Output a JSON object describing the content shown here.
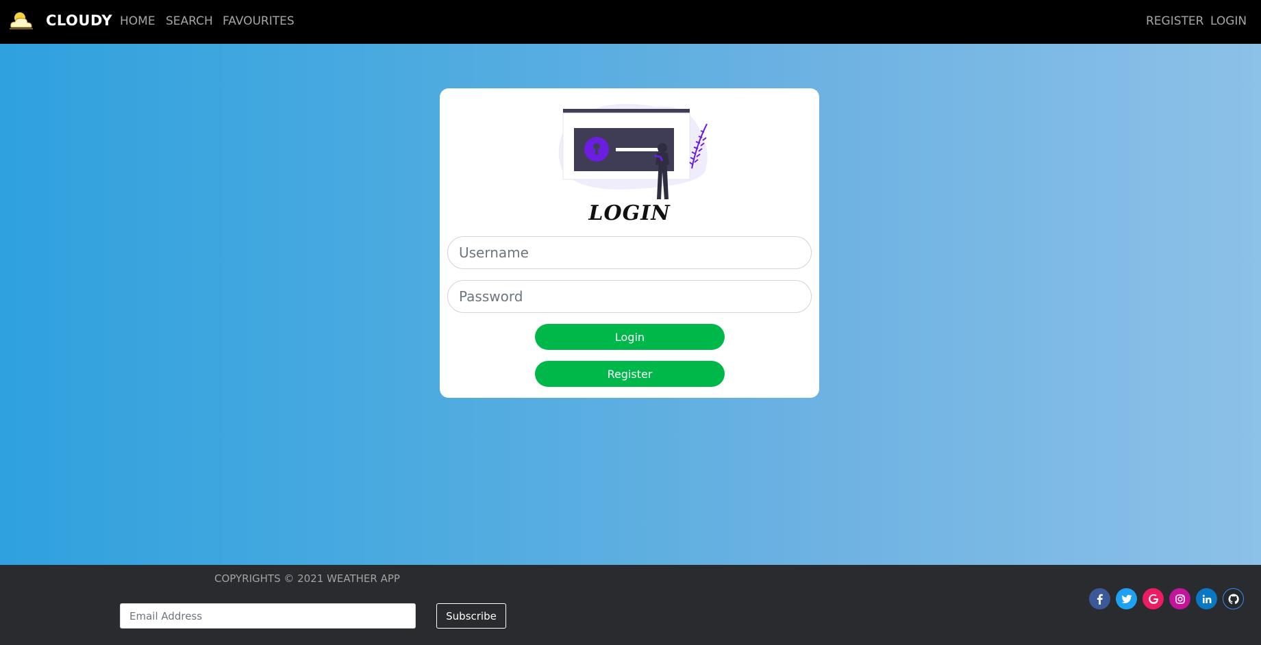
{
  "nav": {
    "brand": "CLOUDY",
    "links": [
      "HOME",
      "SEARCH",
      "FAVOURITES"
    ],
    "right_links": [
      "REGISTER",
      "LOGIN"
    ]
  },
  "login_card": {
    "title": "LOGIN",
    "username_placeholder": "Username",
    "password_placeholder": "Password",
    "login_button": "Login",
    "register_button": "Register"
  },
  "footer": {
    "copyright": "COPYRIGHTS © 2021 WEATHER APP",
    "email_placeholder": "Email Address",
    "subscribe_label": "Subscribe",
    "social_icons": [
      "facebook-icon",
      "twitter-icon",
      "google-icon",
      "instagram-icon",
      "linkedin-icon",
      "github-icon"
    ]
  },
  "colors": {
    "navbar_bg": "#000000",
    "gradient_start": "#2fa1de",
    "gradient_end": "#8cc1e8",
    "button_green": "#00b84a",
    "footer_bg": "#2a2b2e",
    "illustration_accent": "#6c1ee0"
  }
}
